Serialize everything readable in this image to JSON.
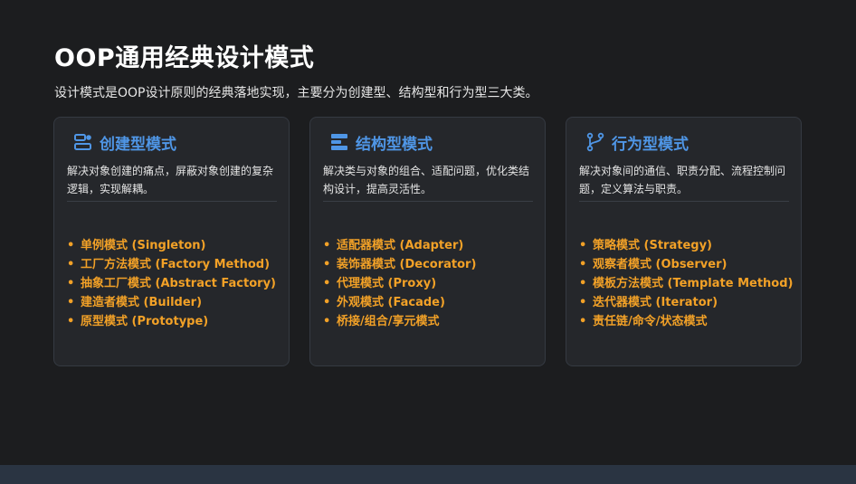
{
  "header": {
    "title": "OOP通用经典设计模式",
    "subtitle": "设计模式是OOP设计原则的经典落地实现，主要分为创建型、结构型和行为型三大类。"
  },
  "colors": {
    "background": "#1c1d1f",
    "card_background": "#25272b",
    "card_title": "#4f96e6",
    "list_item": "#f2a127",
    "footer_bar": "#2a3442"
  },
  "cards": [
    {
      "icon": "creational-icon",
      "title": "创建型模式",
      "description": "解决对象创建的痛点，屏蔽对象创建的复杂逻辑，实现解耦。",
      "items": [
        "单例模式 (Singleton)",
        "工厂方法模式 (Factory Method)",
        "抽象工厂模式 (Abstract Factory)",
        "建造者模式 (Builder)",
        "原型模式 (Prototype)"
      ]
    },
    {
      "icon": "structural-icon",
      "title": "结构型模式",
      "description": "解决类与对象的组合、适配问题，优化类结构设计，提高灵活性。",
      "items": [
        "适配器模式 (Adapter)",
        "装饰器模式 (Decorator)",
        "代理模式 (Proxy)",
        "外观模式 (Facade)",
        "桥接/组合/享元模式"
      ]
    },
    {
      "icon": "behavioral-icon",
      "title": "行为型模式",
      "description": "解决对象间的通信、职责分配、流程控制问题，定义算法与职责。",
      "items": [
        "策略模式 (Strategy)",
        "观察者模式 (Observer)",
        "模板方法模式 (Template Method)",
        "迭代器模式 (Iterator)",
        "责任链/命令/状态模式"
      ]
    }
  ]
}
